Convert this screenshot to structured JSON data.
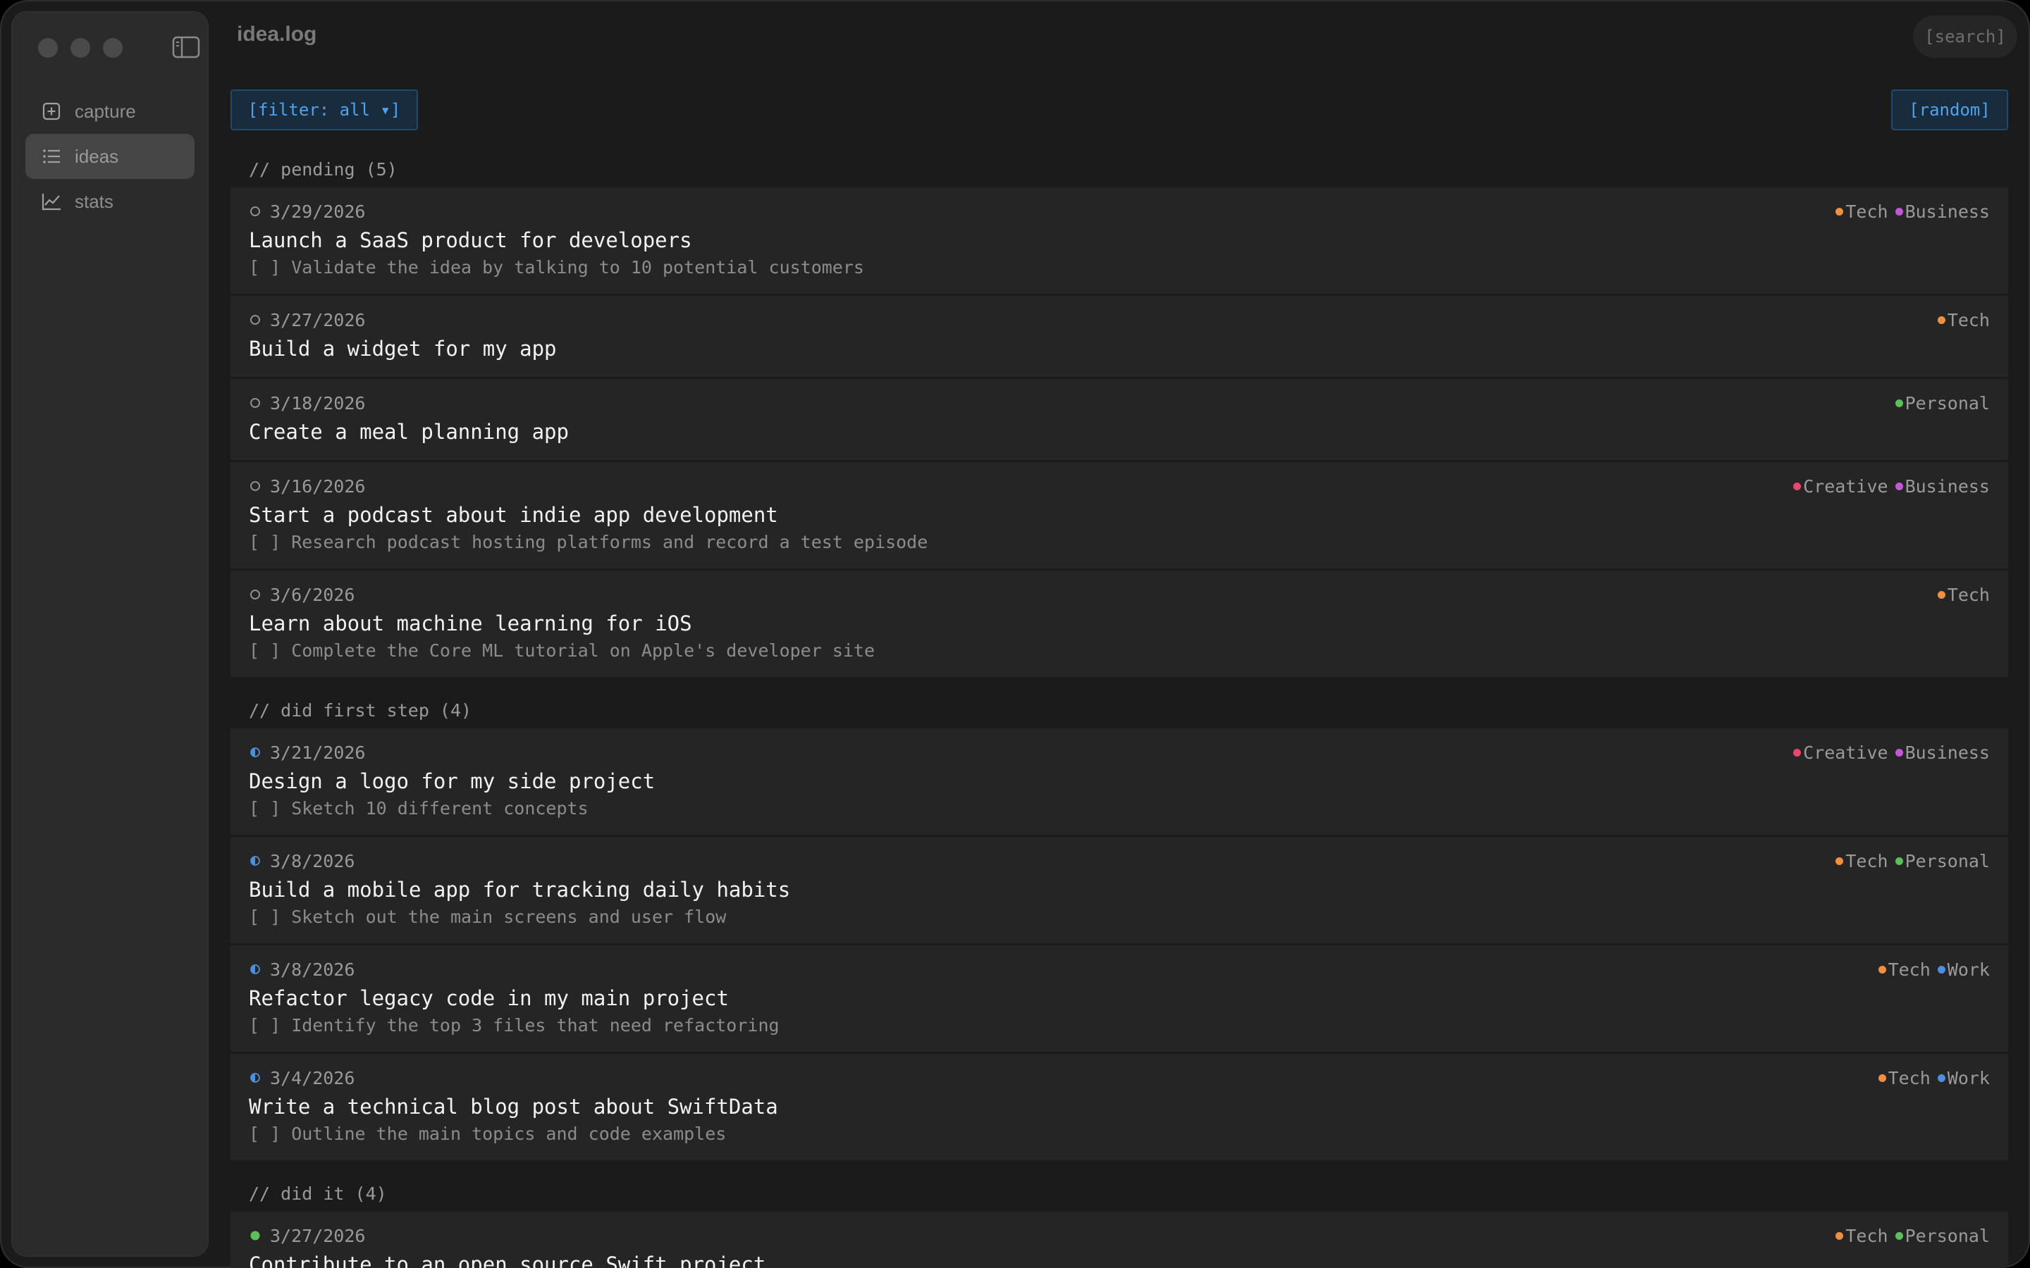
{
  "app": {
    "title": "idea.log"
  },
  "search": {
    "label": "[search]"
  },
  "sidebar": {
    "items": [
      {
        "label": "capture",
        "icon": "plus-square-icon"
      },
      {
        "label": "ideas",
        "icon": "list-icon",
        "active": true
      },
      {
        "label": "stats",
        "icon": "chart-line-icon"
      }
    ]
  },
  "toolbar": {
    "filter_label": "[filter: all ▾]",
    "random_label": "[random]"
  },
  "tag_colors": {
    "Tech": "#f0903e",
    "Business": "#c457d9",
    "Personal": "#5cc05a",
    "Creative": "#e8486a",
    "Work": "#4a90e2"
  },
  "sections": [
    {
      "header": "// pending (5)",
      "status": "pending",
      "ideas": [
        {
          "date": "3/29/2026",
          "title": "Launch a SaaS product for developers",
          "step": "[ ] Validate the idea by talking to 10 potential customers",
          "tags": [
            "Tech",
            "Business"
          ]
        },
        {
          "date": "3/27/2026",
          "title": "Build a widget for my app",
          "step": "",
          "tags": [
            "Tech"
          ]
        },
        {
          "date": "3/18/2026",
          "title": "Create a meal planning app",
          "step": "",
          "tags": [
            "Personal"
          ]
        },
        {
          "date": "3/16/2026",
          "title": "Start a podcast about indie app development",
          "step": "[ ] Research podcast hosting platforms and record a test episode",
          "tags": [
            "Creative",
            "Business"
          ]
        },
        {
          "date": "3/6/2026",
          "title": "Learn about machine learning for iOS",
          "step": "[ ] Complete the Core ML tutorial on Apple's developer site",
          "tags": [
            "Tech"
          ]
        }
      ]
    },
    {
      "header": "// did first step (4)",
      "status": "first-step",
      "ideas": [
        {
          "date": "3/21/2026",
          "title": "Design a logo for my side project",
          "step": "[ ] Sketch 10 different concepts",
          "tags": [
            "Creative",
            "Business"
          ]
        },
        {
          "date": "3/8/2026",
          "title": "Build a mobile app for tracking daily habits",
          "step": "[ ] Sketch out the main screens and user flow",
          "tags": [
            "Tech",
            "Personal"
          ]
        },
        {
          "date": "3/8/2026",
          "title": "Refactor legacy code in my main project",
          "step": "[ ] Identify the top 3 files that need refactoring",
          "tags": [
            "Tech",
            "Work"
          ]
        },
        {
          "date": "3/4/2026",
          "title": "Write a technical blog post about SwiftData",
          "step": "[ ] Outline the main topics and code examples",
          "tags": [
            "Tech",
            "Work"
          ]
        }
      ]
    },
    {
      "header": "// did it (4)",
      "status": "done",
      "ideas": [
        {
          "date": "3/27/2026",
          "title": "Contribute to an open source Swift project",
          "step": "",
          "tags": [
            "Tech",
            "Personal"
          ]
        }
      ]
    }
  ]
}
